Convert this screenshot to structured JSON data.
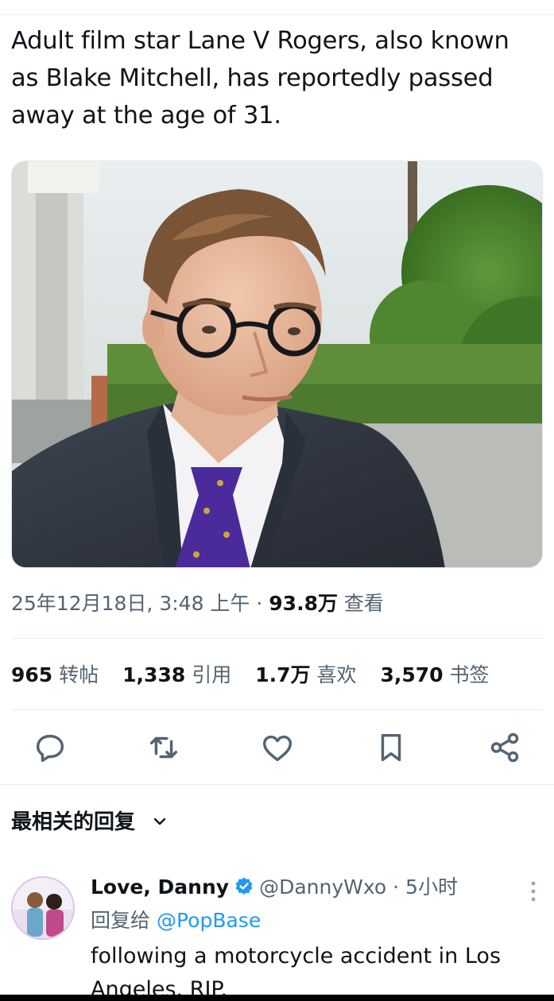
{
  "tweet": {
    "text": "Adult film star Lane V Rogers, also known as Blake Mitchell, has reportedly passed away at the age of 31.",
    "meta": {
      "datetime": "25年12月18日, 3:48 上午",
      "separator": "·",
      "views_count": "93.8万",
      "views_label": "查看"
    },
    "stats": [
      {
        "count": "965",
        "label": "转帖"
      },
      {
        "count": "1,338",
        "label": "引用"
      },
      {
        "count": "1.7万",
        "label": "喜欢"
      },
      {
        "count": "3,570",
        "label": "书签"
      }
    ],
    "actions": [
      "reply-icon",
      "retweet-icon",
      "like-icon",
      "bookmark-icon",
      "share-icon"
    ],
    "media_icon": "photo"
  },
  "replies": {
    "header": "最相关的回复",
    "items": [
      {
        "name": "Love, Danny",
        "handle": "@DannyWxo",
        "separator": "·",
        "time": "5小时",
        "reply_to_label": "回复给",
        "reply_to_handle": "@PopBase",
        "text": "following a motorcycle accident in Los Angeles. RIP."
      }
    ]
  },
  "colors": {
    "text": "#0f1419",
    "secondary": "#536471",
    "accent": "#1d9bf0",
    "icon": "#536471",
    "tie": "#4b2a9c"
  }
}
